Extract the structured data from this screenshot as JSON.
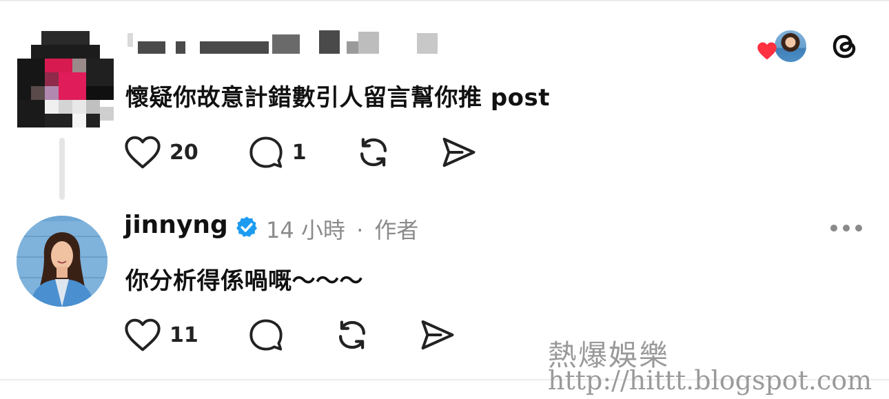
{
  "post1": {
    "author_name_blurred": "",
    "text": "懷疑你故意計錯數引人留言幫你推 post",
    "likes": "20",
    "replies": "1",
    "liked_by_icon": "heart-icon",
    "app_icon": "threads-logo-icon"
  },
  "post2": {
    "username": "jinnyng",
    "verified_icon": "verified-badge-icon",
    "time": "14 小時",
    "separator": "·",
    "author_tag": "作者",
    "text": "你分析得係喎嘅～～～",
    "likes": "11",
    "more_icon": "more-options-icon"
  },
  "actions": {
    "like_icon": "heart-outline-icon",
    "reply_icon": "comment-bubble-icon",
    "repost_icon": "repost-icon",
    "share_icon": "send-icon"
  },
  "watermark": {
    "title": "熱爆娛樂",
    "url": "http://hittt.blogspot.com"
  },
  "colors": {
    "verified_blue": "#1d9bf0",
    "heart_red": "#ff3040",
    "meta_gray": "#8a8a8a"
  }
}
